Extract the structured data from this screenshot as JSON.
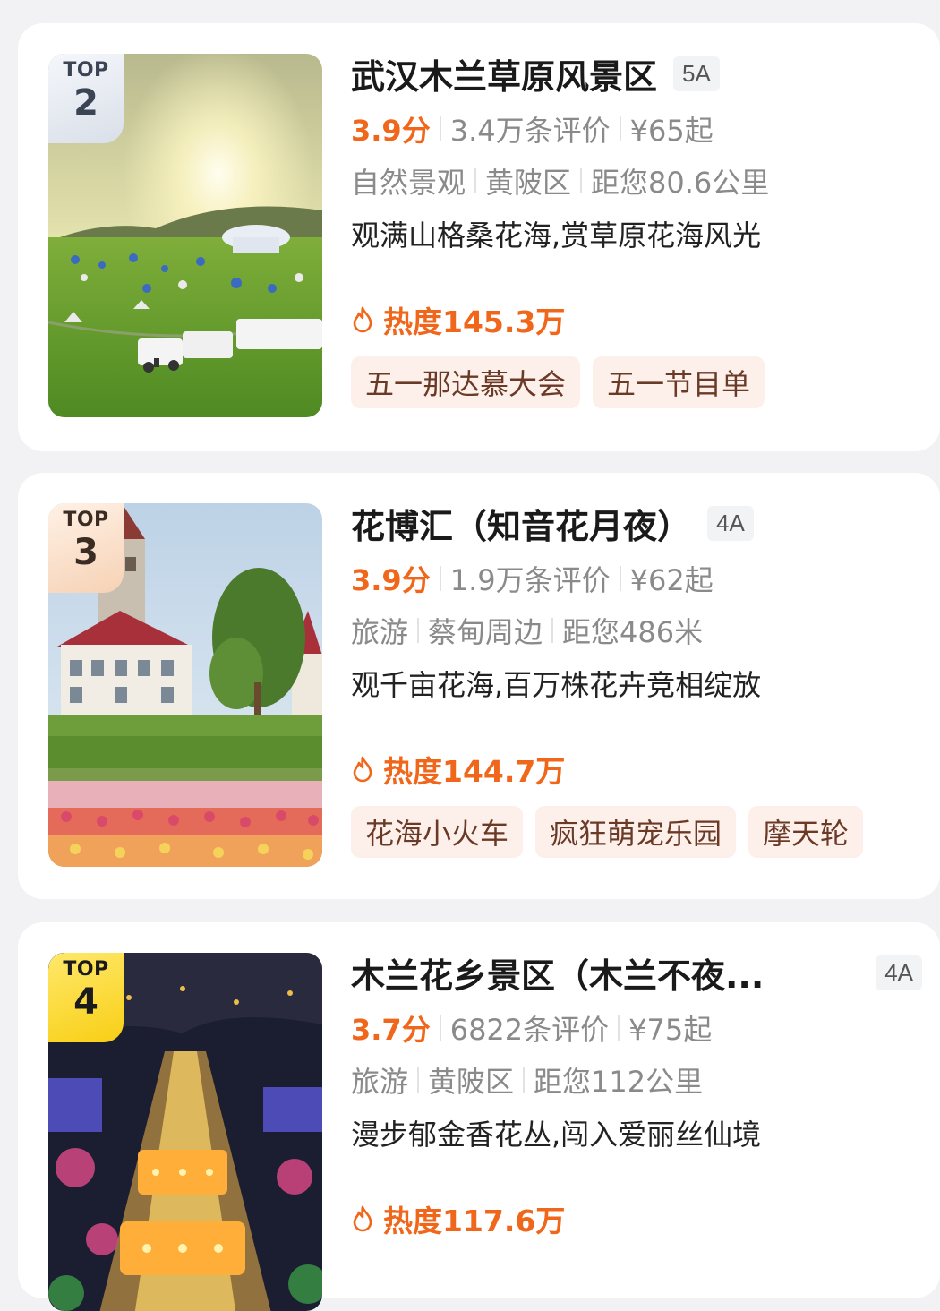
{
  "cards": [
    {
      "badge": {
        "top": "TOP",
        "rank": "2"
      },
      "name": "武汉木兰草原风景区",
      "level": "5A",
      "score": "3.9分",
      "reviews": "3.4万条评价",
      "price": "¥65起",
      "category": "自然景观",
      "area": "黄陂区",
      "distance": "距您80.6公里",
      "desc": "观满山格桑花海,赏草原花海风光",
      "heat": "热度145.3万",
      "tags": [
        "五一那达慕大会",
        "五一节目单"
      ],
      "image": "grassland-train-photo"
    },
    {
      "badge": {
        "top": "TOP",
        "rank": "3"
      },
      "name": "花博汇（知音花月夜）",
      "level": "4A",
      "score": "3.9分",
      "reviews": "1.9万条评价",
      "price": "¥62起",
      "category": "旅游",
      "area": "蔡甸周边",
      "distance": "距您486米",
      "desc": "观千亩花海,百万株花卉竞相绽放",
      "heat": "热度144.7万",
      "tags": [
        "花海小火车",
        "疯狂萌宠乐园",
        "摩天轮"
      ],
      "image": "castle-tulip-photo"
    },
    {
      "badge": {
        "top": "TOP",
        "rank": "4"
      },
      "name": "木兰花乡景区（木兰不夜...",
      "level": "4A",
      "score": "3.7分",
      "reviews": "6822条评价",
      "price": "¥75起",
      "category": "旅游",
      "area": "黄陂区",
      "distance": "距您112公里",
      "desc": "漫步郁金香花丛,闯入爱丽丝仙境",
      "heat": "热度117.6万",
      "tags": [],
      "image": "night-lights-photo"
    }
  ],
  "colors": {
    "accent": "#f0661a",
    "tag_bg": "#fdf0ea",
    "page_bg": "#f2f2f4"
  },
  "icons": {
    "heat": "flame-icon"
  }
}
